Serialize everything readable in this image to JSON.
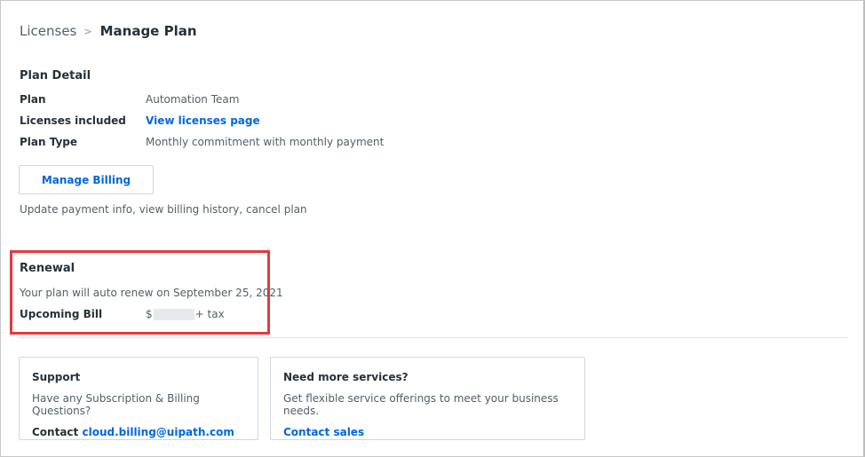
{
  "breadcrumb": {
    "parent": "Licenses",
    "separator": ">",
    "current": "Manage Plan"
  },
  "plan_detail": {
    "title": "Plan Detail",
    "rows": [
      {
        "label": "Plan",
        "value": "Automation Team"
      },
      {
        "label": "Licenses included",
        "value": "View licenses page"
      },
      {
        "label": "Plan Type",
        "value": "Monthly commitment with monthly payment"
      }
    ],
    "manage_billing_label": "Manage Billing",
    "billing_help": "Update payment info, view billing history, cancel plan"
  },
  "renewal": {
    "title": "Renewal",
    "text": "Your plan will auto renew on September 25, 2021",
    "bill_label": "Upcoming Bill",
    "bill_prefix": "$",
    "bill_suffix": "+ tax"
  },
  "support_card": {
    "title": "Support",
    "text": "Have any Subscription & Billing Questions?",
    "contact_label": "Contact",
    "contact_email": "cloud.billing@uipath.com"
  },
  "services_card": {
    "title": "Need more services?",
    "text": "Get flexible service offerings to meet your business needs.",
    "link": "Contact sales"
  },
  "colors": {
    "accent": "#0067df",
    "highlight": "#e5393f",
    "text": "#273139",
    "muted": "#526069"
  }
}
